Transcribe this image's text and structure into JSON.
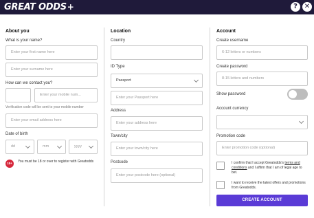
{
  "header": {
    "logo_text": "GREAT ODDS",
    "logo_plus": "+",
    "help_icon": "?",
    "close_icon": "✕"
  },
  "about": {
    "title": "About you",
    "name_label": "What is your name?",
    "first_name_placeholder": "Enter your first name here",
    "surname_placeholder": "Enter your surname here",
    "contact_label": "How can we contact you?",
    "mobile_prefix_value": "",
    "mobile_placeholder": "Enter your mobile num...",
    "verification_hint": "Verification code will be sent to your mobile number",
    "email_placeholder": "Enter your email address here",
    "dob_label": "Date of birth",
    "dob_day": "dd",
    "dob_month": "mm",
    "dob_year": "yyyy",
    "age_badge": "18+",
    "age_notice": "You must be 18 or over to register with Greatodds"
  },
  "location": {
    "title": "Location",
    "country_label": "Country",
    "country_value": "",
    "id_type_label": "ID Type",
    "id_type_value": "Passport",
    "passport_placeholder": "Enter your Passport here",
    "address_label": "Address",
    "address_placeholder": "Enter your address here",
    "town_label": "Town/city",
    "town_placeholder": "Enter your town/city here",
    "postcode_label": "Postcode",
    "postcode_placeholder": "Enter your postcode here (optional)"
  },
  "account": {
    "title": "Account",
    "username_label": "Create username",
    "username_placeholder": "6-12 letters or numbers",
    "password_label": "Create password",
    "password_placeholder": "8-15 letters and numbers",
    "show_password_label": "Show password",
    "show_password_on": false,
    "currency_label": "Account currency",
    "currency_value": "",
    "promo_label": "Promotion code",
    "promo_placeholder": "Enter promotion code (optional)",
    "terms_prefix": "I confirm that I accept Greatodds's ",
    "terms_link": "terms and conditions",
    "terms_suffix": " and I affirm that I am of legal age to bet.",
    "marketing_text": "I want to receive the latest offers and promotions from Greatodds.",
    "submit_label": "CREATE ACCOUNT"
  },
  "colors": {
    "header_bg": "#1f1a3a",
    "accent": "#5a3bd6",
    "age_badge": "#d6283c"
  }
}
